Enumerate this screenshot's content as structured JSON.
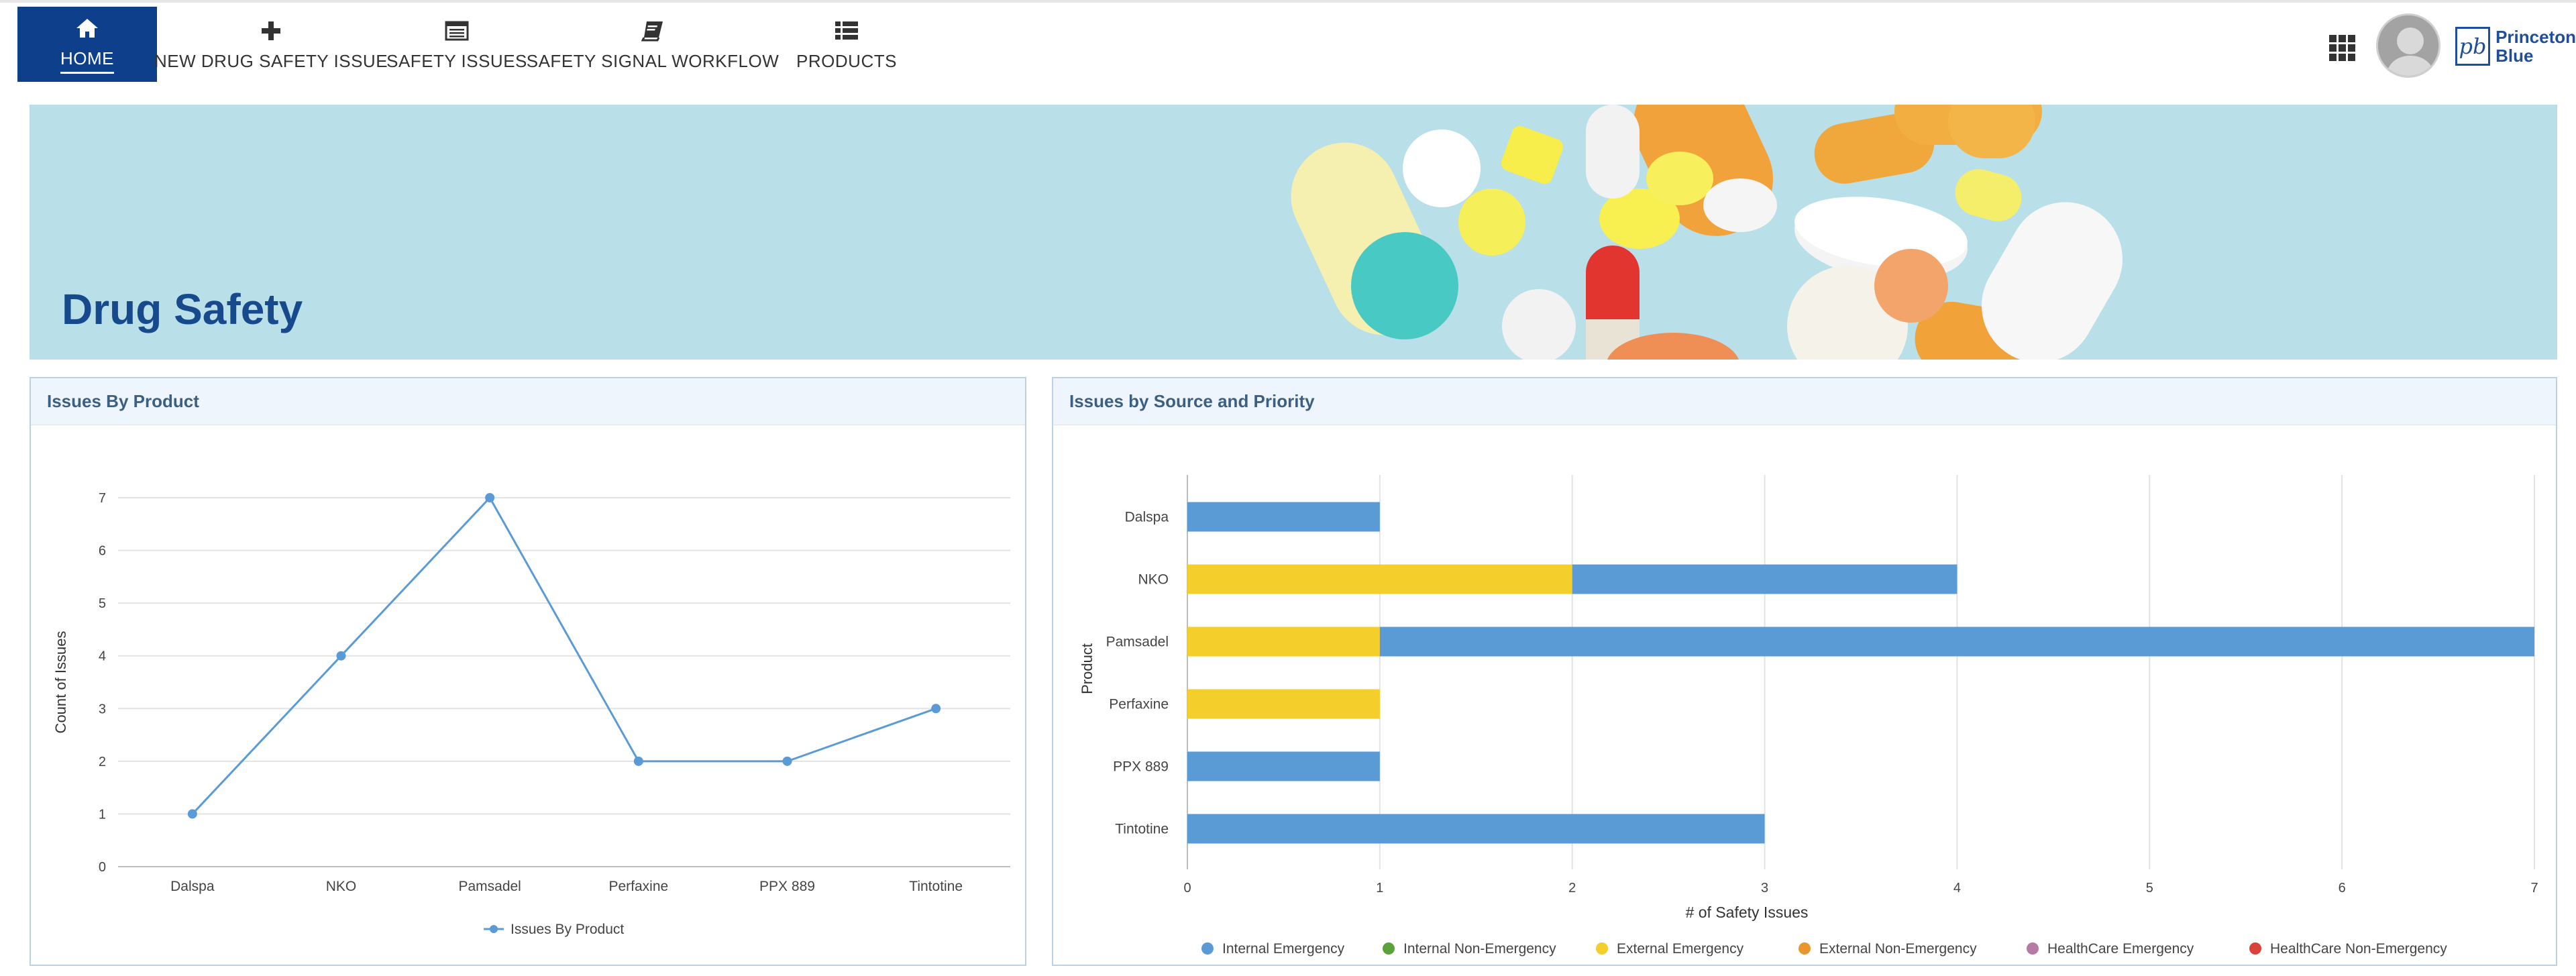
{
  "nav": {
    "items": [
      {
        "label": "HOME",
        "icon": "home-icon"
      },
      {
        "label": "NEW DRUG SAFETY ISSUE",
        "icon": "plus-icon"
      },
      {
        "label": "SAFETY ISSUES",
        "icon": "list-window-icon"
      },
      {
        "label": "SAFETY SIGNAL WORKFLOW",
        "icon": "book-icon"
      },
      {
        "label": "PRODUCTS",
        "icon": "list-icon"
      }
    ],
    "active_color": "#0e3f8b"
  },
  "brand": {
    "line1": "Princeton",
    "line2": "Blue",
    "mark": "pb",
    "color": "#1f4e9a"
  },
  "banner": {
    "title": "Drug Safety",
    "background": "#b9dfe9"
  },
  "panels": {
    "left_title": "Issues By Product",
    "right_title": "Issues by Source and Priority"
  },
  "chart_data": [
    {
      "type": "line",
      "title": "Issues By Product",
      "categories": [
        "Dalspa",
        "NKO",
        "Pamsadel",
        "Perfaxine",
        "PPX 889",
        "Tintotine"
      ],
      "series": [
        {
          "name": "Issues By Product",
          "values": [
            1,
            4,
            7,
            2,
            2,
            3
          ],
          "color": "#5b9bd5"
        }
      ],
      "xlabel": "",
      "ylabel": "Count of Issues",
      "ylim": [
        0,
        7
      ],
      "yticks": [
        0,
        1,
        2,
        3,
        4,
        5,
        6,
        7
      ],
      "grid": true,
      "legend": "bottom"
    },
    {
      "type": "bar",
      "orientation": "horizontal",
      "stacked": true,
      "title": "Issues by Source and Priority",
      "categories": [
        "Dalspa",
        "NKO",
        "Pamsadel",
        "Perfaxine",
        "PPX 889",
        "Tintotine"
      ],
      "series": [
        {
          "name": "Internal Emergency",
          "values": [
            1,
            2,
            6,
            0,
            1,
            3
          ],
          "color": "#5b9bd5"
        },
        {
          "name": "Internal Non-Emergency",
          "values": [
            0,
            0,
            0,
            0,
            0,
            0
          ],
          "color": "#5aa33b"
        },
        {
          "name": "External Emergency",
          "values": [
            0,
            2,
            1,
            1,
            0,
            0
          ],
          "color": "#f4ce2b"
        },
        {
          "name": "External Non-Emergency",
          "values": [
            0,
            0,
            0,
            0,
            0,
            0
          ],
          "color": "#e8962e"
        },
        {
          "name": "HealthCare Emergency",
          "values": [
            0,
            0,
            0,
            0,
            0,
            0
          ],
          "color": "#b57ba6"
        },
        {
          "name": "HealthCare Non-Emergency",
          "values": [
            0,
            0,
            0,
            0,
            0,
            0
          ],
          "color": "#d9433a"
        }
      ],
      "stack_order": [
        "External Emergency",
        "Internal Emergency"
      ],
      "xlabel": "# of Safety Issues",
      "ylabel": "Product",
      "xlim": [
        0,
        7
      ],
      "xticks": [
        0,
        1,
        2,
        3,
        4,
        5,
        6,
        7
      ],
      "grid": true,
      "legend": "bottom"
    }
  ]
}
